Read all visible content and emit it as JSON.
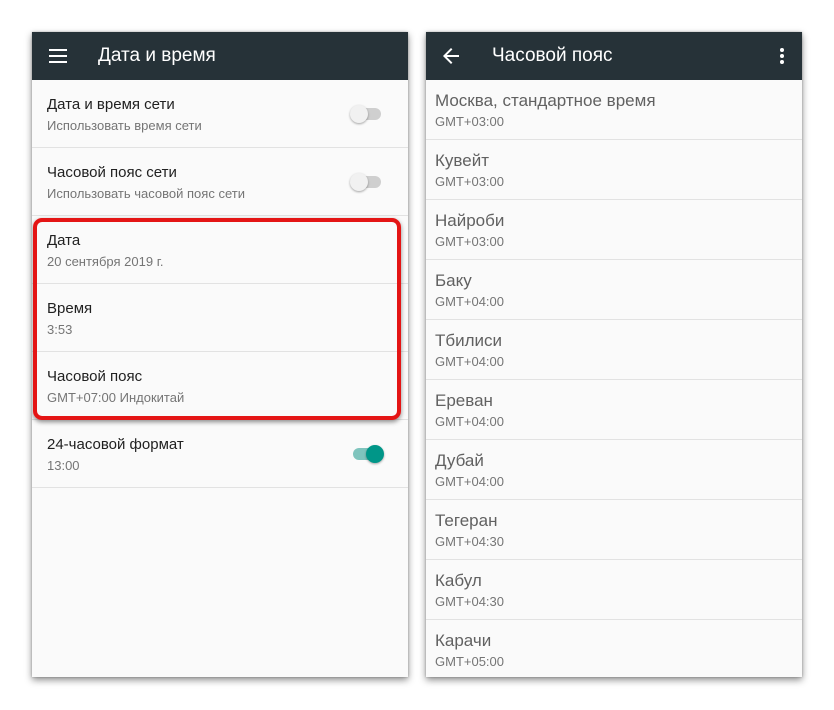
{
  "left_screen": {
    "title": "Дата и время",
    "menu_icon": "hamburger-menu-icon",
    "items": [
      {
        "title": "Дата и время сети",
        "subtitle": "Использовать время сети",
        "toggle": "off"
      },
      {
        "title": "Часовой пояс сети",
        "subtitle": "Использовать часовой пояс сети",
        "toggle": "off"
      },
      {
        "title": "Дата",
        "subtitle": "20 сентября 2019 г."
      },
      {
        "title": "Время",
        "subtitle": "3:53"
      },
      {
        "title": "Часовой пояс",
        "subtitle": "GMT+07:00 Индокитай"
      },
      {
        "title": "24-часовой формат",
        "subtitle": "13:00",
        "toggle": "on"
      }
    ]
  },
  "right_screen": {
    "title": "Часовой пояс",
    "back_icon": "arrow-back-icon",
    "overflow_icon": "more-vert-icon",
    "zones": [
      {
        "name": "Москва, стандартное время",
        "offset": "GMT+03:00"
      },
      {
        "name": "Кувейт",
        "offset": "GMT+03:00"
      },
      {
        "name": "Найроби",
        "offset": "GMT+03:00"
      },
      {
        "name": "Баку",
        "offset": "GMT+04:00"
      },
      {
        "name": "Тбилиси",
        "offset": "GMT+04:00"
      },
      {
        "name": "Ереван",
        "offset": "GMT+04:00"
      },
      {
        "name": "Дубай",
        "offset": "GMT+04:00"
      },
      {
        "name": "Тегеран",
        "offset": "GMT+04:30"
      },
      {
        "name": "Кабул",
        "offset": "GMT+04:30"
      },
      {
        "name": "Карачи",
        "offset": "GMT+05:00"
      }
    ]
  },
  "colors": {
    "app_bar": "#263238",
    "accent": "#009688",
    "highlight": "#e41515"
  }
}
